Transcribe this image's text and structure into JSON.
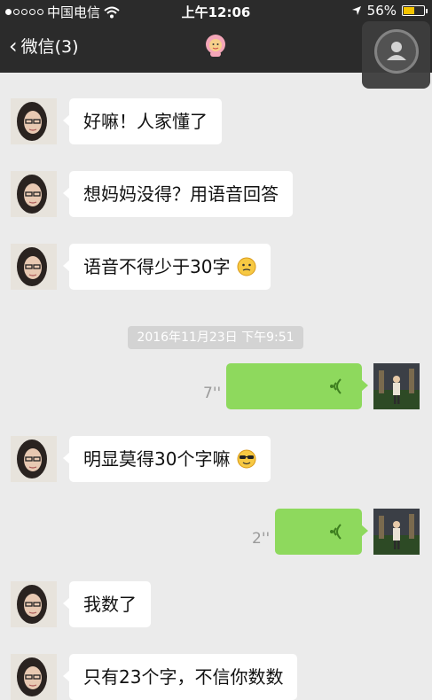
{
  "status_bar": {
    "carrier": "中国电信",
    "time": "上午12:06",
    "battery": "56%",
    "battery_level": 0.56
  },
  "nav": {
    "back_label": "微信(3)"
  },
  "timestamp": "2016年11月23日 下午9:51",
  "messages": [
    {
      "text": "好嘛！人家懂了"
    },
    {
      "text": "想妈妈没得？用语音回答"
    },
    {
      "text": "语音不得少于30字"
    },
    {
      "voice_duration": "7''"
    },
    {
      "text": "明显莫得30个字嘛"
    },
    {
      "voice_duration": "2''"
    },
    {
      "text": "我数了"
    },
    {
      "text": "只有23个字，不信你数数"
    }
  ],
  "colors": {
    "header_bg": "#2b2b2b",
    "chat_bg": "#ebebeb",
    "voice_bubble": "#8ed95d",
    "battery_fill": "#f5c400"
  }
}
